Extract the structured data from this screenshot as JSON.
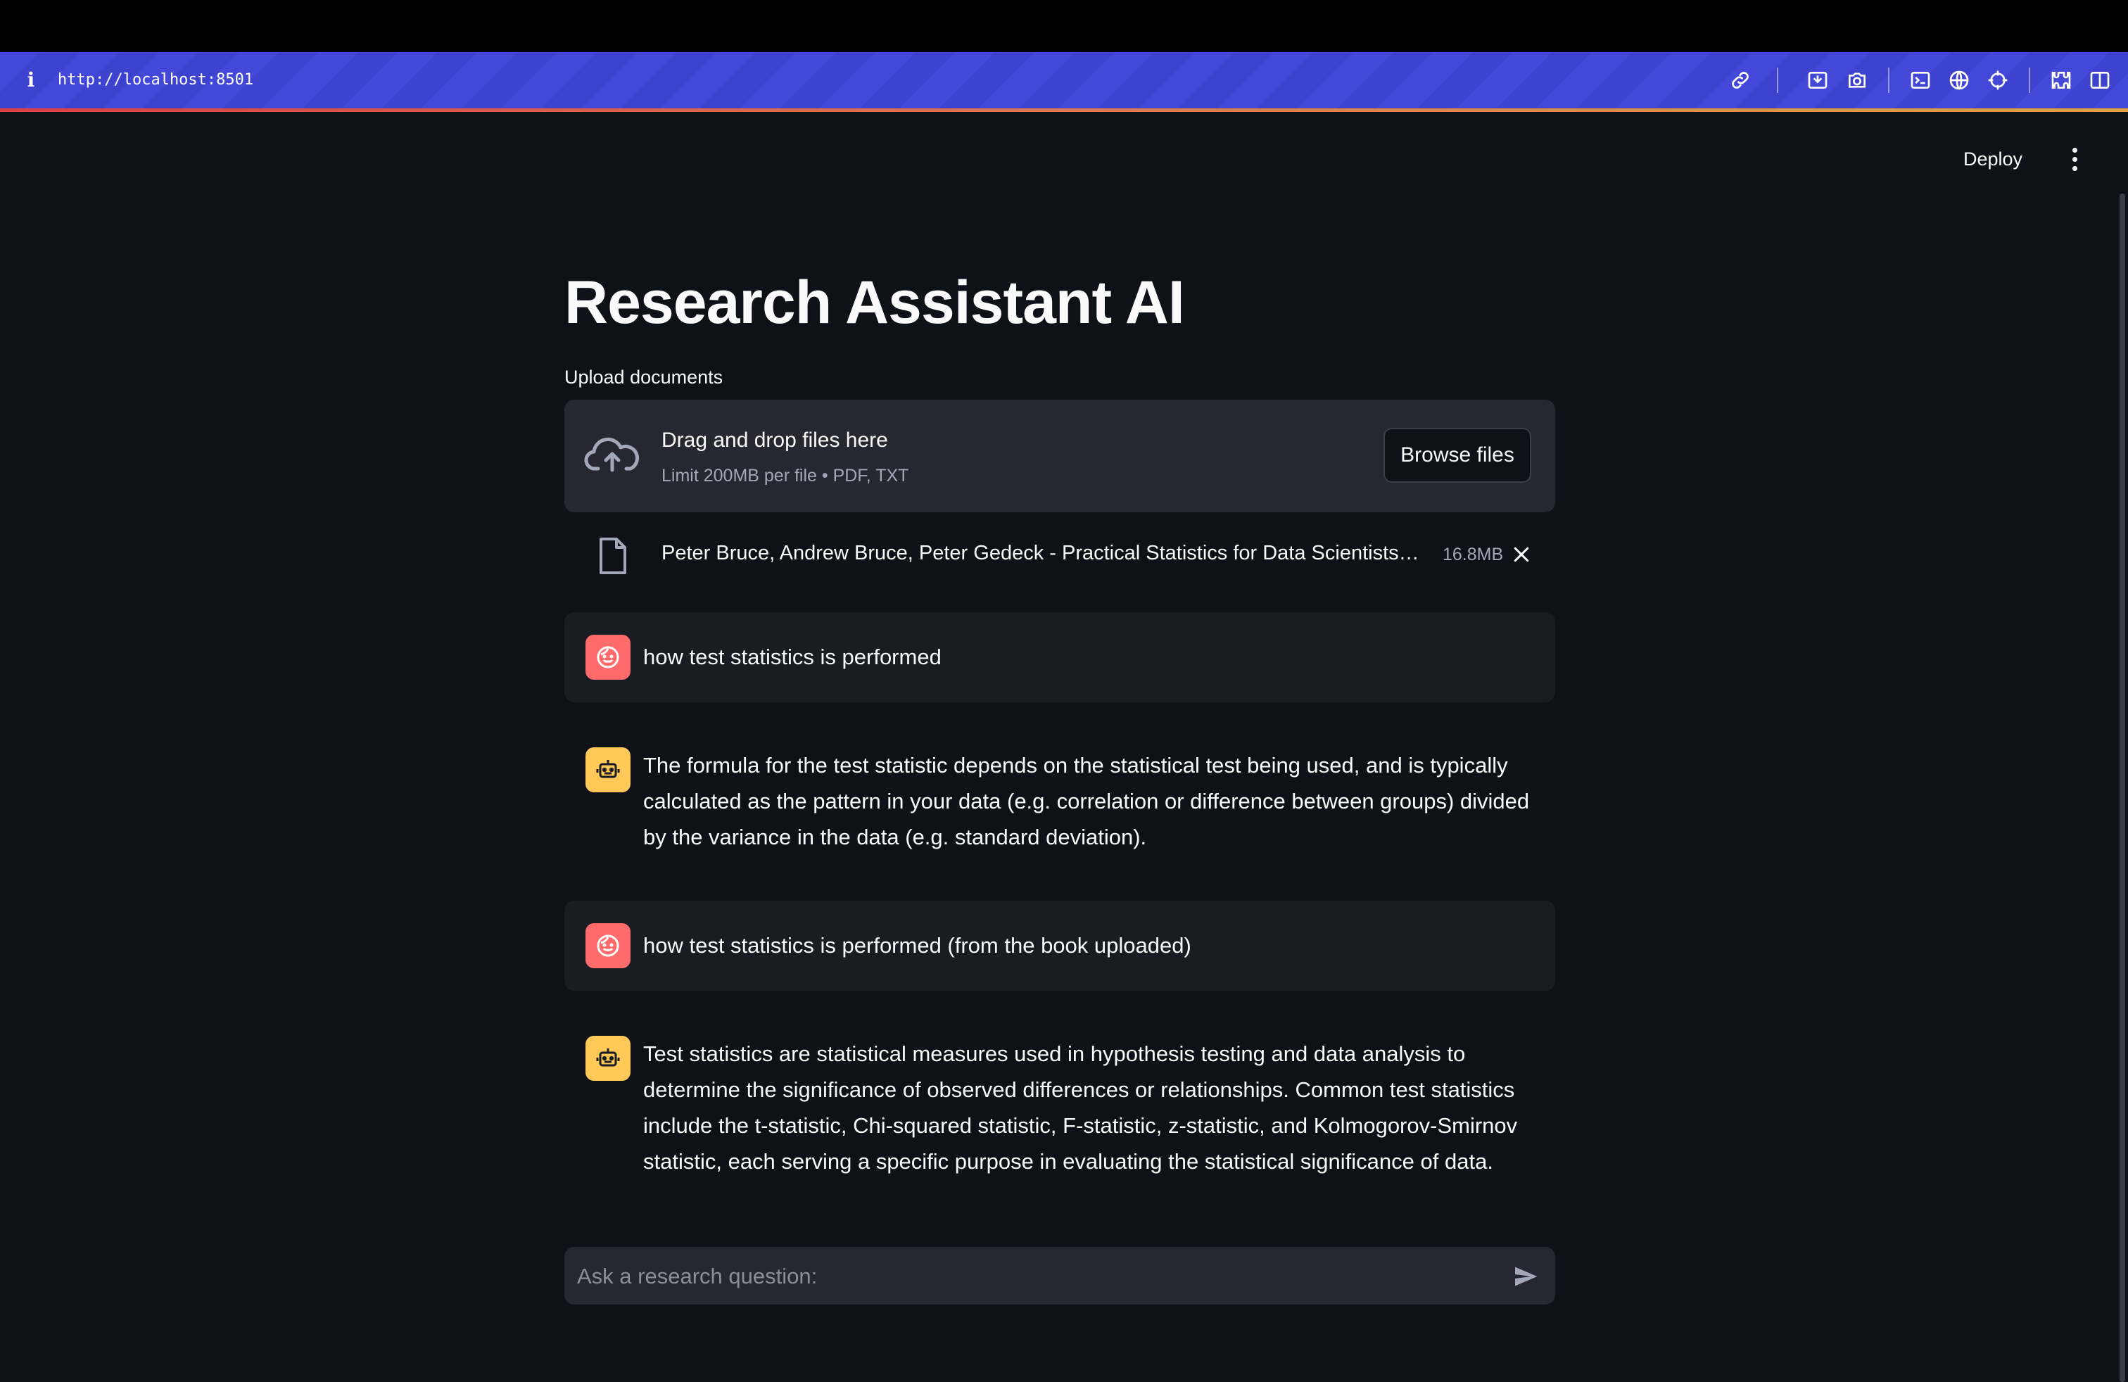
{
  "browser": {
    "url": "http://localhost:8501",
    "info_glyph": "i",
    "toolbar_icons": [
      "link-icon",
      "screenshot-icon",
      "camera-icon",
      "terminal-icon",
      "globe-icon",
      "crosshair-icon",
      "extensions-icon",
      "split-view-icon"
    ],
    "accent_color": "#4348d8"
  },
  "header": {
    "deploy_label": "Deploy",
    "menu_icon": "more-vertical-icon"
  },
  "app": {
    "title": "Research Assistant AI"
  },
  "uploader": {
    "label": "Upload documents",
    "drop_title": "Drag and drop files here",
    "drop_subtitle": "Limit 200MB per file • PDF, TXT",
    "browse_label": "Browse files",
    "file": {
      "name": "Peter Bruce, Andrew Bruce, Peter Gedeck - Practical Statistics for Data Scientists…",
      "size": "16.8MB"
    }
  },
  "chat": {
    "messages": [
      {
        "role": "user",
        "text": "how test statistics is performed"
      },
      {
        "role": "assistant",
        "text": "The formula for the test statistic depends on the statistical test being used, and is typically calculated as the pattern in your data (e.g. correlation or difference between groups) divided by the variance in the data (e.g. standard deviation)."
      },
      {
        "role": "user",
        "text": "how test statistics is performed (from the book uploaded)"
      },
      {
        "role": "assistant",
        "text": "Test statistics are statistical measures used in hypothesis testing and data analysis to determine the significance of observed differences or relationships. Common test statistics include the t-statistic, Chi-squared statistic, F-statistic, z-statistic, and Kolmogorov-Smirnov statistic, each serving a specific purpose in evaluating the statistical significance of data."
      }
    ],
    "input_placeholder": "Ask a research question:",
    "colors": {
      "user_avatar": "#ff6b6b",
      "assistant_avatar": "#ffc857"
    }
  }
}
